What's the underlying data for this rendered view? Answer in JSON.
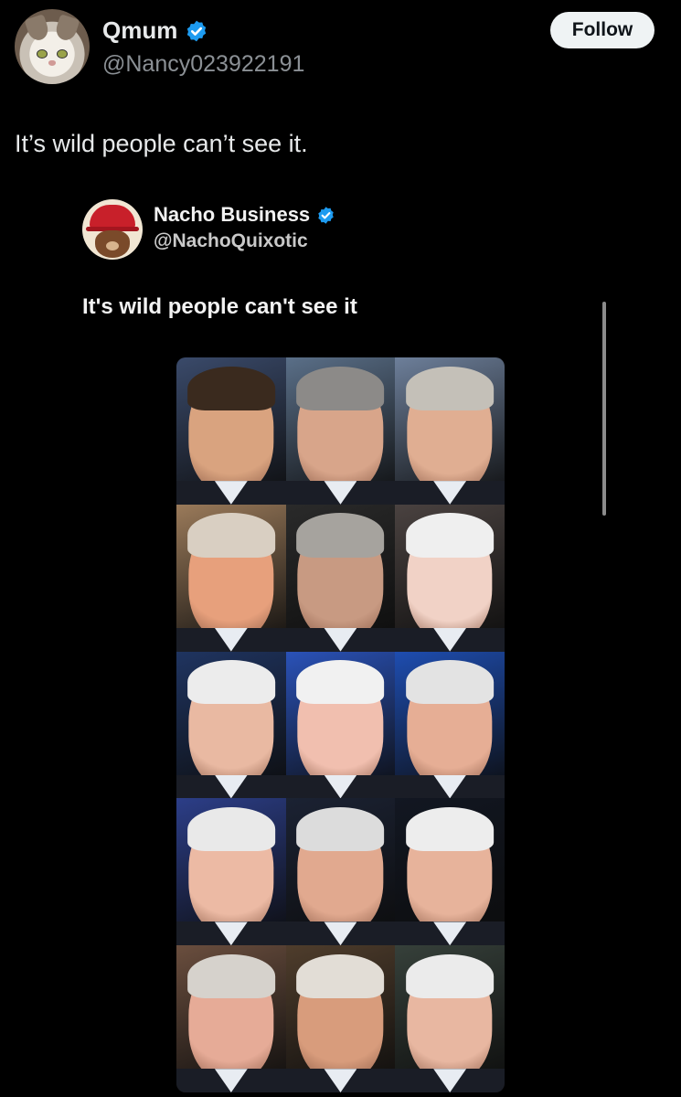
{
  "author": {
    "display_name": "Qmum",
    "handle": "@Nancy023922191",
    "verified": true,
    "avatar_icon": "cat-avatar-icon"
  },
  "follow_label": "Follow",
  "tweet_text": "It’s wild people can’t see it.",
  "quoted": {
    "display_name": "Nacho Business",
    "handle": "@NachoQuixotic",
    "verified": true,
    "avatar_icon": "bear-red-hat-avatar-icon",
    "text": "It's wild people can't see it"
  },
  "photo_grid": {
    "rows": 5,
    "columns": 3,
    "tiles": [
      {
        "bg": "#3a4a6a",
        "skin": "#d9a37f",
        "hair": "#3a2a1e"
      },
      {
        "bg": "#5a6f88",
        "skin": "#d8a58a",
        "hair": "#8c8a88"
      },
      {
        "bg": "#6d7f9a",
        "skin": "#e0ae92",
        "hair": "#c4c0b8"
      },
      {
        "bg": "#9a7a5a",
        "skin": "#e7a07c",
        "hair": "#d9cfc2"
      },
      {
        "bg": "#2a2a2a",
        "skin": "#c89a82",
        "hair": "#a6a39e"
      },
      {
        "bg": "#4a4240",
        "skin": "#f1d2c6",
        "hair": "#efefef"
      },
      {
        "bg": "#1f3460",
        "skin": "#e9b9a2",
        "hair": "#ececec"
      },
      {
        "bg": "#2a52b8",
        "skin": "#f1bfaf",
        "hair": "#f1f1f1"
      },
      {
        "bg": "#1e4db0",
        "skin": "#e6ae95",
        "hair": "#e3e3e3"
      },
      {
        "bg": "#2c3e88",
        "skin": "#ecbaa4",
        "hair": "#e9e9e9"
      },
      {
        "bg": "#1b2233",
        "skin": "#e1a98f",
        "hair": "#dcdcdc"
      },
      {
        "bg": "#121722",
        "skin": "#e7b39b",
        "hair": "#ededed"
      },
      {
        "bg": "#6a4e3e",
        "skin": "#e6ab97",
        "hair": "#d6d2cc"
      },
      {
        "bg": "#4f3d2c",
        "skin": "#d89c7c",
        "hair": "#e2ddd6"
      },
      {
        "bg": "#36403a",
        "skin": "#e8b7a1",
        "hair": "#ebebeb"
      }
    ]
  },
  "colors": {
    "background": "#000000",
    "verified_blue": "#1d9bf0",
    "follow_bg": "#eff3f4",
    "muted_text": "#8b9095"
  }
}
